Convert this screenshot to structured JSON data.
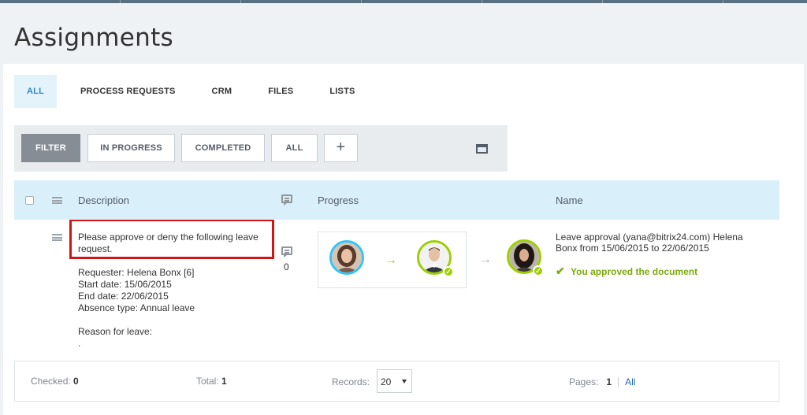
{
  "header": {
    "title": "Assignments"
  },
  "tabs": [
    {
      "label": "ALL",
      "active": true
    },
    {
      "label": "PROCESS REQUESTS",
      "active": false
    },
    {
      "label": "CRM",
      "active": false
    },
    {
      "label": "FILES",
      "active": false
    },
    {
      "label": "LISTS",
      "active": false
    }
  ],
  "filter_bar": {
    "filter_label": "FILTER",
    "in_progress_label": "IN PROGRESS",
    "completed_label": "COMPLETED",
    "all_label": "ALL",
    "add_label": "+"
  },
  "grid": {
    "columns": {
      "description": "Description",
      "progress": "Progress",
      "name": "Name"
    },
    "row": {
      "description_main": "Please approve or deny the following leave request.",
      "details": {
        "requester": "Requester: Helena Bonx [6]",
        "start": "Start date: 15/06/2015",
        "end": "End date: 22/06/2015",
        "absence": "Absence type: Annual leave",
        "reason": "Reason for leave:",
        "reason_value": "."
      },
      "comment_count": "0",
      "name": "Leave approval (yana@bitrix24.com) Helena Bonx from 15/06/2015 to 22/06/2015",
      "status": "You approved the document",
      "arrow_1": "→",
      "arrow_2": "→",
      "check": "✓",
      "status_icon": "✔"
    }
  },
  "footer": {
    "checked_label": "Checked:",
    "checked_value": "0",
    "total_label": "Total:",
    "total_value": "1",
    "records_label": "Records:",
    "records_value": "20",
    "pages_label": "Pages:",
    "pages_current": "1",
    "pages_all": "All"
  },
  "colors": {
    "accent_blue": "#2fc6f6",
    "accent_green": "#9dcf00",
    "status_green": "#7bab0f",
    "highlight_red": "#cc1717",
    "grid_header": "#d9eff9"
  }
}
